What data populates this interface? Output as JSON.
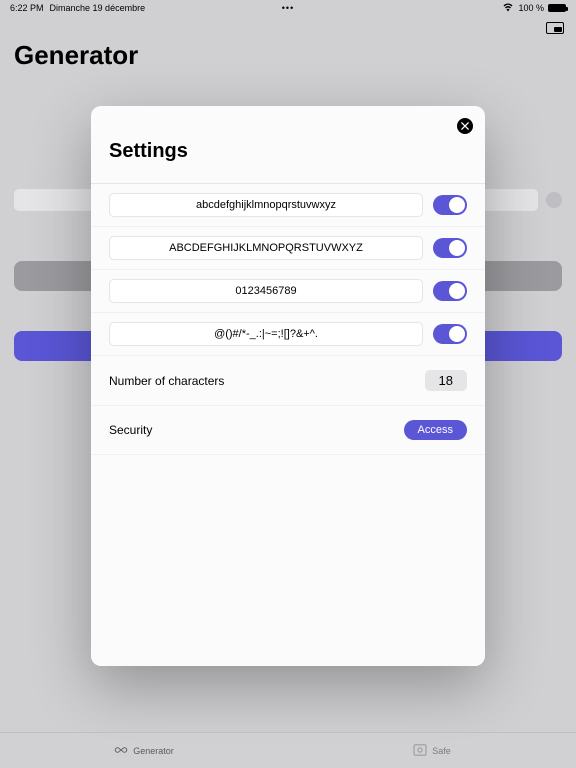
{
  "statusbar": {
    "time": "6:22 PM",
    "date": "Dimanche 19 décembre",
    "center": "•••",
    "battery_pct": "100 %"
  },
  "page": {
    "title": "Generator"
  },
  "modal": {
    "title": "Settings",
    "rows": {
      "lowercase": "abcdefghijklmnopqrstuvwxyz",
      "uppercase": "ABCDEFGHIJKLMNOPQRSTUVWXYZ",
      "digits": "0123456789",
      "symbols": "@()#/*-_.:|~=;![]?&+^."
    },
    "num_chars_label": "Number of characters",
    "num_chars_value": "18",
    "security_label": "Security",
    "access_label": "Access"
  },
  "tabs": {
    "generator": "Generator",
    "safe": "Safe"
  }
}
